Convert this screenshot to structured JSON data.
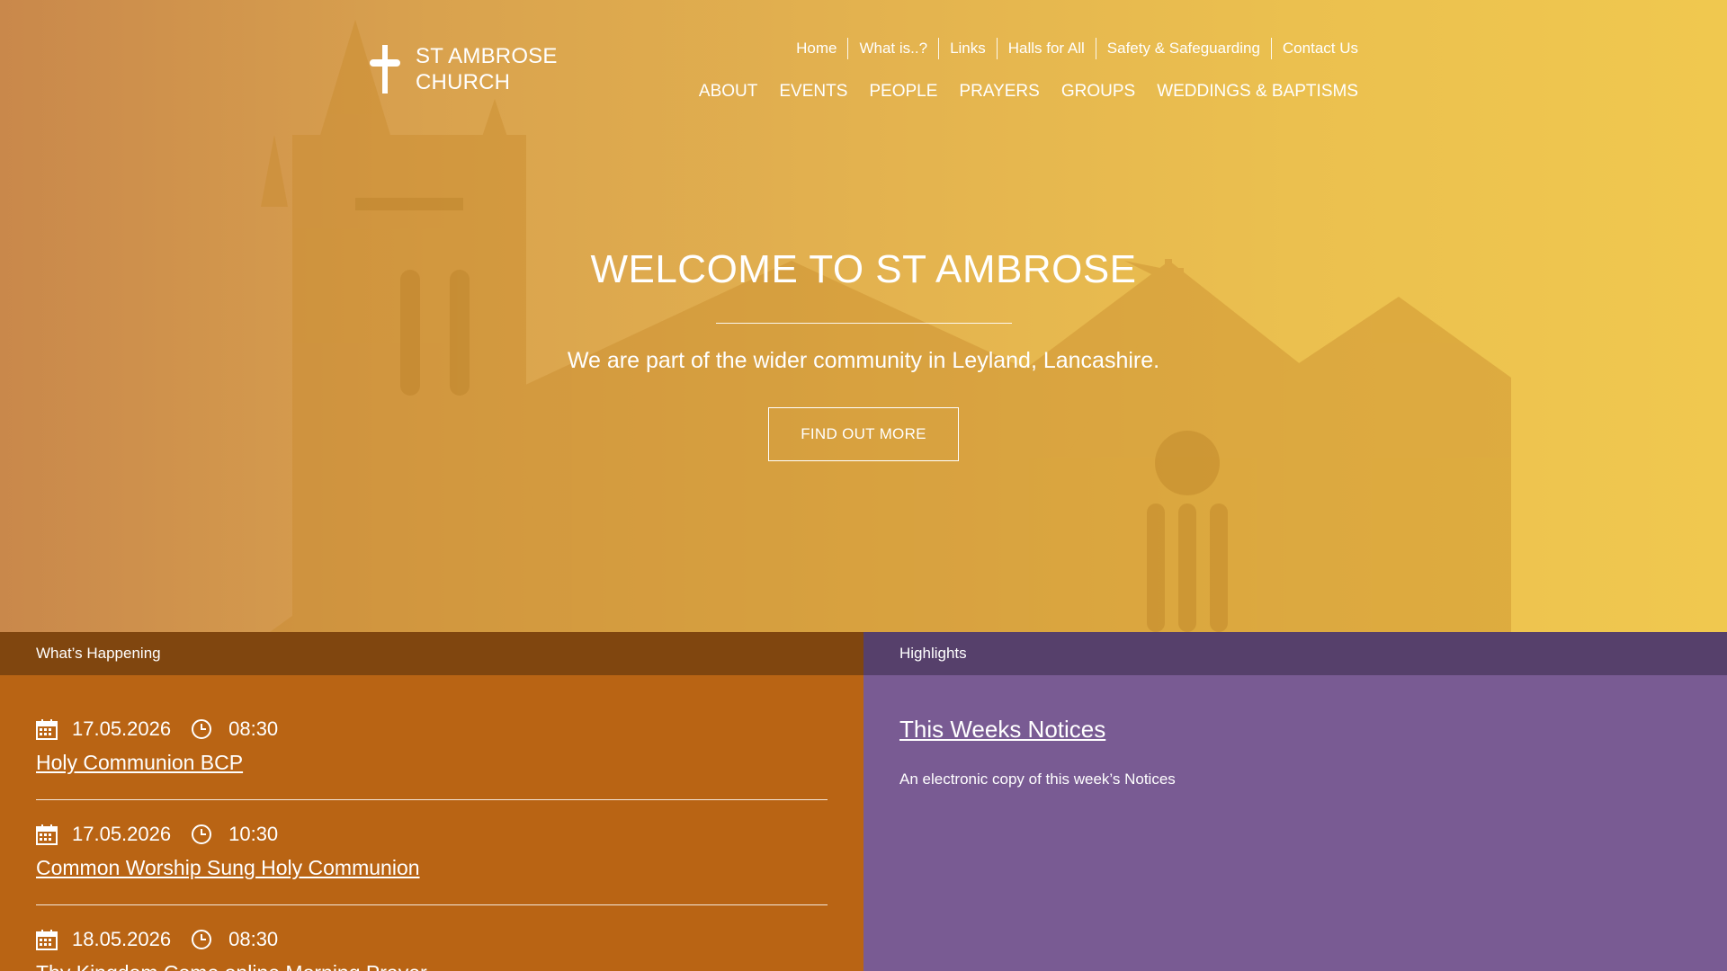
{
  "header": {
    "logo_line1": "ST AMBROSE",
    "logo_line2": "CHURCH",
    "top_links": [
      "Home",
      "What is..?",
      "Links",
      "Halls for All",
      "Safety & Safeguarding",
      "Contact Us"
    ],
    "main_links": [
      "ABOUT",
      "EVENTS",
      "PEOPLE",
      "PRAYERS",
      "GROUPS",
      "WEDDINGS & BAPTISMS"
    ]
  },
  "hero": {
    "title": "WELCOME TO ST AMBROSE",
    "subtitle": "We are part of the wider community in Leyland, Lancashire.",
    "button_label": "FIND OUT MORE"
  },
  "happening": {
    "heading": "What’s Happening",
    "events": [
      {
        "date": "17.05.2026",
        "time": "08:30",
        "title": "Holy Communion BCP"
      },
      {
        "date": "17.05.2026",
        "time": "10:30",
        "title": "Common Worship Sung Holy Communion"
      },
      {
        "date": "18.05.2026",
        "time": "08:30",
        "title": "Thy Kingdom Come online Morning Prayer"
      }
    ]
  },
  "highlights": {
    "heading": "Highlights",
    "title": "This Weeks Notices",
    "description": "An electronic copy of this week’s Notices"
  },
  "colors": {
    "hero_left": "#c9884b",
    "hero_right": "#f0c84f",
    "orange_panel": "#b96414",
    "orange_header": "#80460f",
    "purple_panel": "#795b93",
    "purple_header": "#56406b"
  },
  "icons": {
    "logo": "cross-icon",
    "date": "calendar-icon",
    "time": "clock-icon"
  }
}
